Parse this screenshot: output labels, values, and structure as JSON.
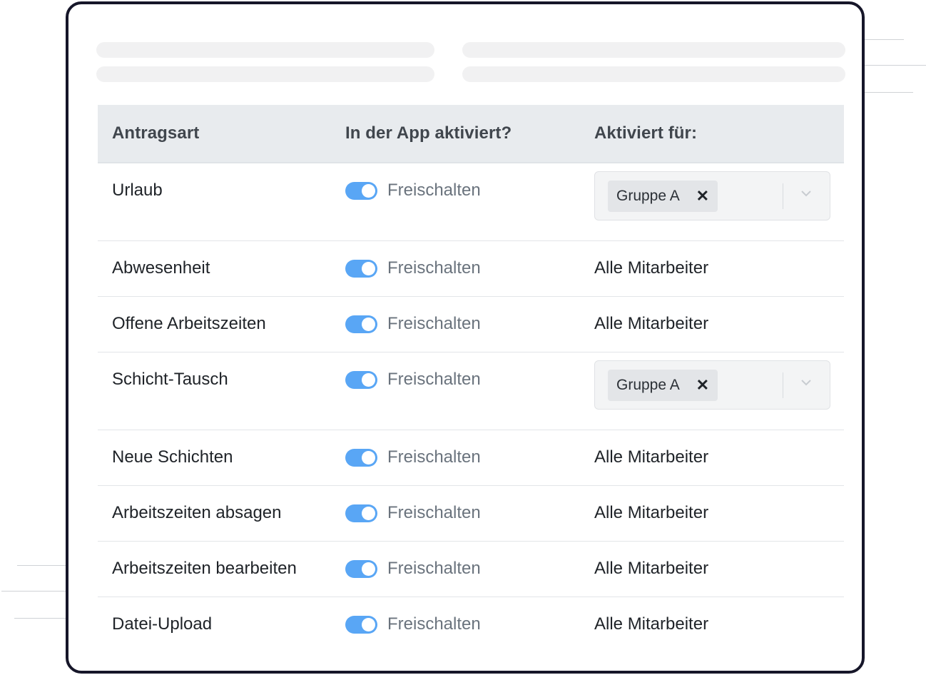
{
  "table": {
    "headers": {
      "type": "Antragsart",
      "enabled": "In der App aktiviert?",
      "active_for": "Aktiviert für:"
    },
    "rows": [
      {
        "type": "Urlaub",
        "toggle_label": "Freischalten",
        "toggle_on": true,
        "active_for": {
          "kind": "select",
          "chip": "Gruppe A"
        }
      },
      {
        "type": "Abwesenheit",
        "toggle_label": "Freischalten",
        "toggle_on": true,
        "active_for": {
          "kind": "text",
          "text": "Alle Mitarbeiter"
        }
      },
      {
        "type": "Offene Arbeitszeiten",
        "toggle_label": "Freischalten",
        "toggle_on": true,
        "active_for": {
          "kind": "text",
          "text": "Alle Mitarbeiter"
        }
      },
      {
        "type": "Schicht-Tausch",
        "toggle_label": "Freischalten",
        "toggle_on": true,
        "active_for": {
          "kind": "select",
          "chip": "Gruppe A"
        }
      },
      {
        "type": "Neue Schichten",
        "toggle_label": "Freischalten",
        "toggle_on": true,
        "active_for": {
          "kind": "text",
          "text": "Alle Mitarbeiter"
        }
      },
      {
        "type": "Arbeitszeiten absagen",
        "toggle_label": "Freischalten",
        "toggle_on": true,
        "active_for": {
          "kind": "text",
          "text": "Alle Mitarbeiter"
        }
      },
      {
        "type": "Arbeitszeiten bearbeiten",
        "toggle_label": "Freischalten",
        "toggle_on": true,
        "active_for": {
          "kind": "text",
          "text": "Alle Mitarbeiter"
        }
      },
      {
        "type": "Datei-Upload",
        "toggle_label": "Freischalten",
        "toggle_on": true,
        "active_for": {
          "kind": "text",
          "text": "Alle Mitarbeiter"
        }
      }
    ]
  },
  "chip_remove_glyph": "✕",
  "colors": {
    "toggle_on": "#59a6f5",
    "header_bg": "#e8ebee",
    "card_border": "#161629"
  },
  "icons": {
    "chip_remove": "close-icon",
    "select_open": "chevron-down-icon"
  }
}
